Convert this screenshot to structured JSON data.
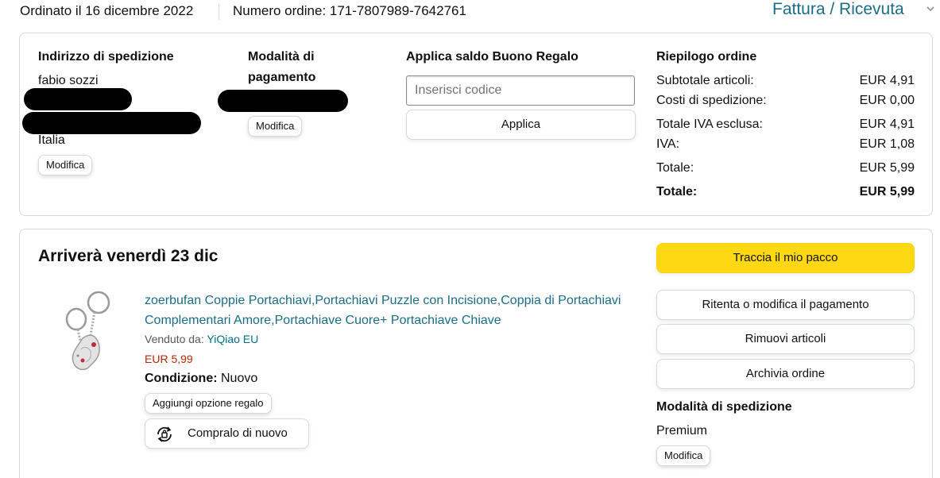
{
  "header": {
    "ordered_on": "Ordinato il 16 dicembre 2022",
    "order_number": "Numero ordine: 171-7807989-7642761",
    "invoice_link": "Fattura / Ricevuta"
  },
  "shipping_address": {
    "title": "Indirizzo di spedizione",
    "name": "fabio sozzi",
    "country": "Italia",
    "edit_label": "Modifica"
  },
  "payment": {
    "title_line1": "Modalità di",
    "title_line2": "pagamento",
    "edit_label": "Modifica"
  },
  "gift_card": {
    "title": "Applica saldo Buono Regalo",
    "input_placeholder": "Inserisci codice",
    "apply_label": "Applica"
  },
  "summary": {
    "title": "Riepilogo ordine",
    "rows": [
      {
        "label": "Subtotale articoli:",
        "value": "EUR 4,91"
      },
      {
        "label": "Costi di spedizione:",
        "value": "EUR 0,00"
      },
      {
        "label": "Totale IVA esclusa:",
        "value": "EUR 4,91"
      },
      {
        "label": "IVA:",
        "value": "EUR 1,08"
      },
      {
        "label": "Totale:",
        "value": "EUR 5,99"
      },
      {
        "label": "Totale:",
        "value": "EUR 5,99"
      }
    ]
  },
  "shipment": {
    "arrival": "Arriverà venerdì 23 dic",
    "product_title": "zoerbufan Coppie Portachiavi,Portachiavi Puzzle con Incisione,Coppia di Portachiavi Complementari Amore,Portachiave Cuore+ Portachiave Chiave",
    "sold_by_label": "Venduto da:",
    "seller": "YiQiao EU",
    "price": "EUR 5,99",
    "condition_label": "Condizione:",
    "condition_value": "Nuovo",
    "gift_option_label": "Aggiungi opzione regalo",
    "buy_again_label": "Compralo di nuovo"
  },
  "actions": {
    "track": "Traccia il mio pacco",
    "retry_payment": "Ritenta o modifica il pagamento",
    "remove_items": "Rimuovi articoli",
    "archive": "Archivia ordine"
  },
  "delivery_method": {
    "title": "Modalità di spedizione",
    "value": "Premium",
    "edit_label": "Modifica"
  },
  "colors": {
    "link": "#1a6d85",
    "price": "#b12704",
    "track_button": "#ffd814"
  }
}
